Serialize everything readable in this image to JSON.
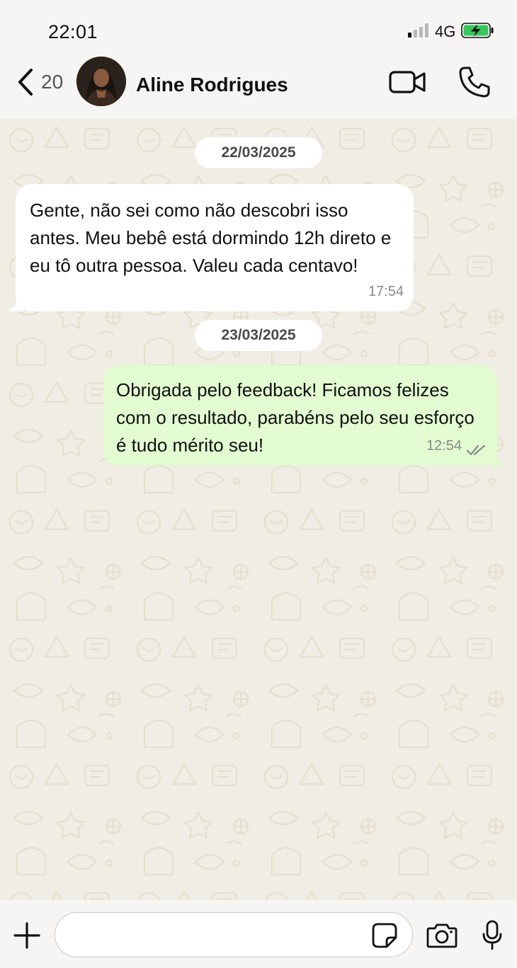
{
  "status_bar": {
    "time": "22:01",
    "network": "4G"
  },
  "header": {
    "back_count": "20",
    "contact_name": "Aline Rodrigues",
    "avatar": "contact-photo"
  },
  "conversation": {
    "date_1": "22/03/2025",
    "incoming_message": {
      "text": "Gente, não sei como não descobri isso antes. Meu bebê está dormindo 12h direto e eu tô outra pessoa. Valeu cada centavo!",
      "time": "17:54"
    },
    "date_2": "23/03/2025",
    "outgoing_message": {
      "text": "Obrigada pelo feedback! Ficamos felizes com o resultado, parabéns pelo seu esforço é tudo mérito seu!",
      "time": "12:54",
      "status": "read-double-check"
    }
  },
  "composer": {
    "placeholder": "",
    "value": ""
  },
  "icons": {
    "back": "chevron-left-icon",
    "video": "video-camera-icon",
    "call": "phone-icon",
    "attach": "plus-icon",
    "sticker": "sticker-icon",
    "camera": "camera-icon",
    "mic": "microphone-icon"
  },
  "colors": {
    "chat_background": "#f0ede4",
    "incoming_bubble": "#ffffff",
    "outgoing_bubble": "#e2fbd0",
    "bar_background": "#f6f5f3",
    "battery_charging": "#34c759"
  }
}
